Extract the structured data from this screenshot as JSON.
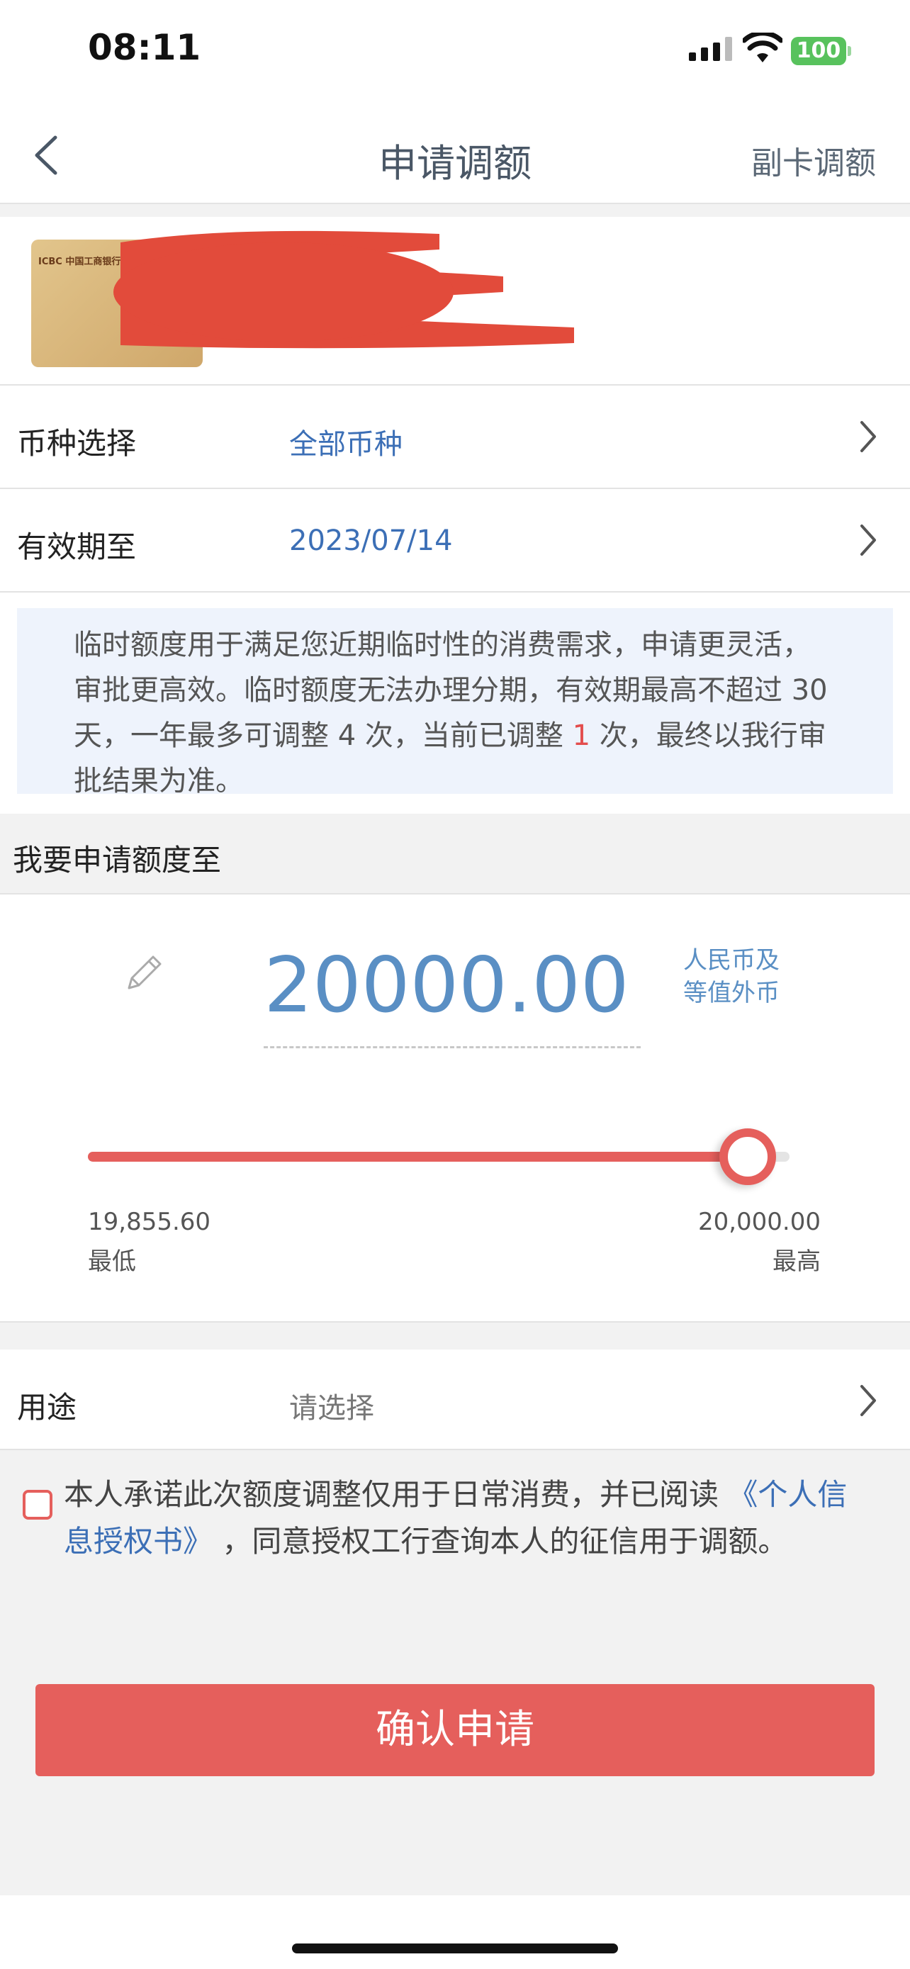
{
  "status_bar": {
    "time": "08:11",
    "battery": "100"
  },
  "nav": {
    "title": "申请调额",
    "right_action": "副卡调额"
  },
  "card": {
    "logo_text": "ICBC 中国工商银行"
  },
  "currency_row": {
    "label": "币种选择",
    "value": "全部币种"
  },
  "expiry_row": {
    "label": "有效期至",
    "value": "2023/07/14"
  },
  "info": {
    "text_before": "临时额度用于满足您近期临时性的消费需求，申请更灵活，审批更高效。临时额度无法办理分期，有效期最高不超过 30 天，一年最多可调整 4 次，当前已调整 ",
    "adjusted_count": "1",
    "text_after": " 次，最终以我行审批结果为准。"
  },
  "section_title": "我要申请额度至",
  "amount": {
    "value": "20000.00",
    "currency_line1": "人民币及",
    "currency_line2": "等值外币",
    "slider_level": 0.94,
    "min_value": "19,855.60",
    "min_label": "最低",
    "max_value": "20,000.00",
    "max_label": "最高"
  },
  "purpose_row": {
    "label": "用途",
    "value": "请选择"
  },
  "agreement": {
    "text_before": "本人承诺此次额度调整仅用于日常消费，并已阅读 ",
    "link": "《个人信息授权书》",
    "text_after": " ，同意授权工行查询本人的征信用于调额。"
  },
  "confirm_button": "确认申请",
  "colors": {
    "accent_red": "#e55f5c",
    "link_blue": "#3c6fb6",
    "amount_blue": "#5a8fc4"
  }
}
